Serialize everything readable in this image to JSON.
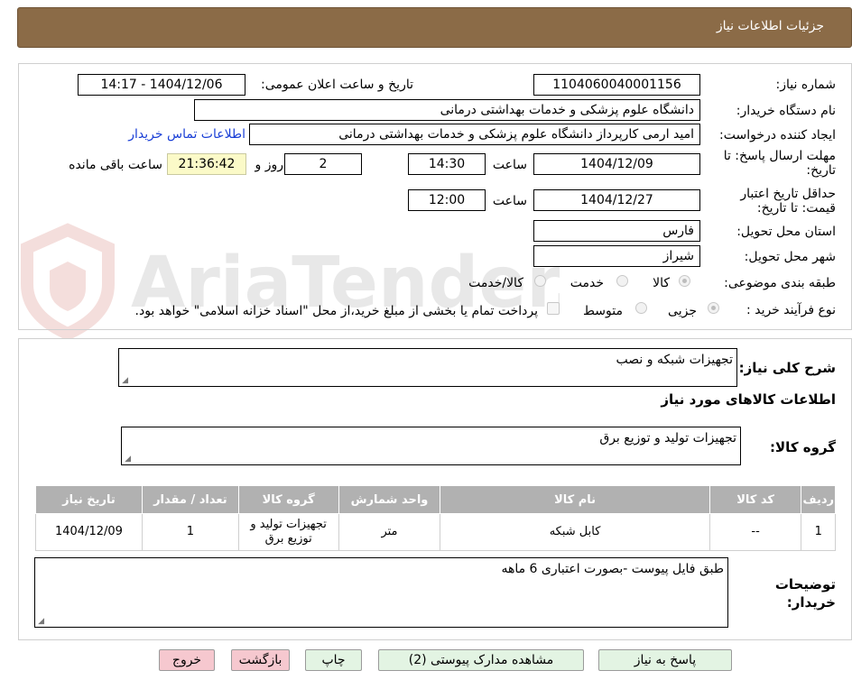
{
  "header": {
    "title": "جزئیات اطلاعات نیاز"
  },
  "watermark": {
    "text": "AriaTender.neT"
  },
  "form": {
    "need_number_label": "شماره نیاز:",
    "need_number": "1104060040001156",
    "announce_label": "تاریخ و ساعت اعلان عمومی:",
    "announce_value": "1404/12/06 - 14:17",
    "buyer_org_label": "نام دستگاه خریدار:",
    "buyer_org": "دانشگاه علوم پزشکی و خدمات بهداشتی درمانی",
    "creator_label": "ایجاد کننده درخواست:",
    "creator": "امید  ارمی کارپرداز دانشگاه علوم پزشکی و خدمات بهداشتی درمانی",
    "contact_link": "اطلاعات تماس خریدار",
    "deadline_label": "مهلت ارسال پاسخ: تا تاریخ:",
    "deadline_date": "1404/12/09",
    "time_label": "ساعت",
    "deadline_time": "14:30",
    "days": "2",
    "days_label": "روز و",
    "remaining_time": "21:36:42",
    "remaining_label": "ساعت باقی مانده",
    "validity_label": "حداقل تاریخ اعتبار قیمت: تا تاریخ:",
    "validity_date": "1404/12/27",
    "validity_time": "12:00",
    "province_label": "استان محل تحویل:",
    "province": "فارس",
    "city_label": "شهر محل تحویل:",
    "city": "شیراز",
    "category_label": "طبقه بندی موضوعی:",
    "category_options": [
      "کالا",
      "خدمت",
      "کالا/خدمت"
    ],
    "category_selected": "کالا",
    "process_label": "نوع فرآیند خرید :",
    "process_options": [
      "جزیی",
      "متوسط"
    ],
    "process_selected": "جزیی",
    "payment_note": "پرداخت تمام یا بخشی از مبلغ خرید،از محل \"اسناد خزانه اسلامی\" خواهد بود."
  },
  "details": {
    "summary_label": "شرح کلی نیاز:",
    "summary": "تجهیزات شبکه و نصب",
    "goods_info_title": "اطلاعات کالاهای مورد نیاز",
    "goods_group_label": "گروه کالا:",
    "goods_group": "تجهیزات تولید و توزیع برق",
    "table": {
      "headers": [
        "ردیف",
        "کد کالا",
        "نام کالا",
        "واحد شمارش",
        "گروه کالا",
        "تعداد / مقدار",
        "تاریخ نیاز"
      ],
      "rows": [
        [
          "1",
          "--",
          "کابل شبکه",
          "متر",
          "تجهیزات تولید و توزیع برق",
          "1",
          "1404/12/09"
        ]
      ]
    },
    "buyer_notes_label": "توضیحات خریدار:",
    "buyer_notes": "طبق فایل پیوست -بصورت اعتباری 6 ماهه"
  },
  "buttons": {
    "reply": "پاسخ به نیاز",
    "attachments": "مشاهده مدارک پیوستی (2)",
    "print": "چاپ",
    "back": "بازگشت",
    "exit": "خروج"
  },
  "colors": {
    "header_bg": "#8b6b47",
    "remaining_bg": "#fbfac8",
    "table_header_bg": "#b1b1b1",
    "exit_bg": "#f6c8cf",
    "reply_bg": "#e3f4e3",
    "link": "#1a3fd6"
  }
}
